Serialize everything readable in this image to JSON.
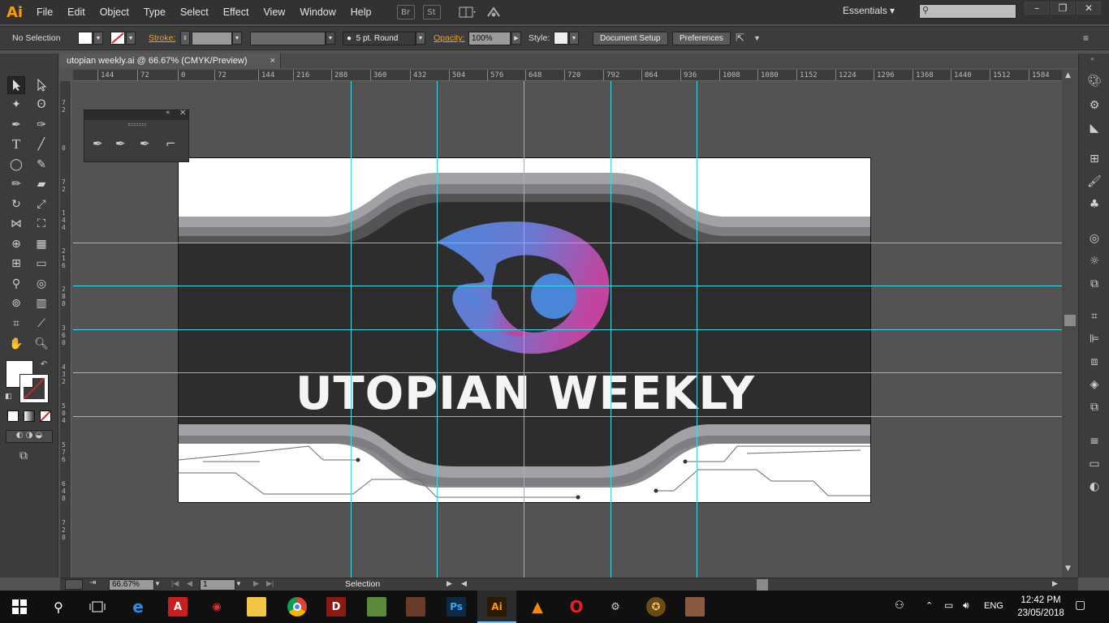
{
  "app": {
    "logo": "Ai",
    "menu": [
      "File",
      "Edit",
      "Object",
      "Type",
      "Select",
      "Effect",
      "View",
      "Window",
      "Help"
    ],
    "bridge_icon": "Br",
    "stock_icon": "St",
    "workspace": "Essentials",
    "search_placeholder": ""
  },
  "control_bar": {
    "selection": "No Selection",
    "stroke_label": "Stroke:",
    "brush": "5 pt. Round",
    "opacity_label": "Opacity:",
    "opacity_value": "100%",
    "style_label": "Style:",
    "document_setup": "Document Setup",
    "preferences": "Preferences"
  },
  "document": {
    "tab_title": "utopian weekly.ai @ 66.67% (CMYK/Preview)",
    "close": "×"
  },
  "ruler": {
    "top_ticks": [
      "144",
      "72",
      "0",
      "72",
      "144",
      "216",
      "288",
      "360",
      "432",
      "504",
      "576",
      "648",
      "720",
      "792",
      "864",
      "936",
      "1008",
      "1080",
      "1152",
      "1224",
      "1296",
      "1368",
      "1440",
      "1512",
      "1584"
    ],
    "left_ticks": [
      "7\n2",
      "0",
      "7\n2",
      "1\n4\n4",
      "2\n1\n6",
      "2\n8\n8",
      "3\n6\n0",
      "4\n3\n2",
      "5\n0\n4",
      "5\n7\n6",
      "6\n4\n8",
      "7\n2\n0"
    ]
  },
  "artwork": {
    "headline": "UTOPIAN WEEKLY",
    "colors": {
      "dark_band": "#2d2d2d",
      "gray_1": "#a1a1a6",
      "gray_2": "#7e7e82",
      "gray_3": "#545456",
      "eye_blue": "#4a86d8",
      "eye_magenta": "#c2449e",
      "guide": "#3fd8e6"
    }
  },
  "status_bar": {
    "zoom": "66.67%",
    "page": "1",
    "tool": "Selection"
  },
  "taskbar": {
    "language": "ENG",
    "time": "12:42 PM",
    "date": "23/05/2018"
  }
}
